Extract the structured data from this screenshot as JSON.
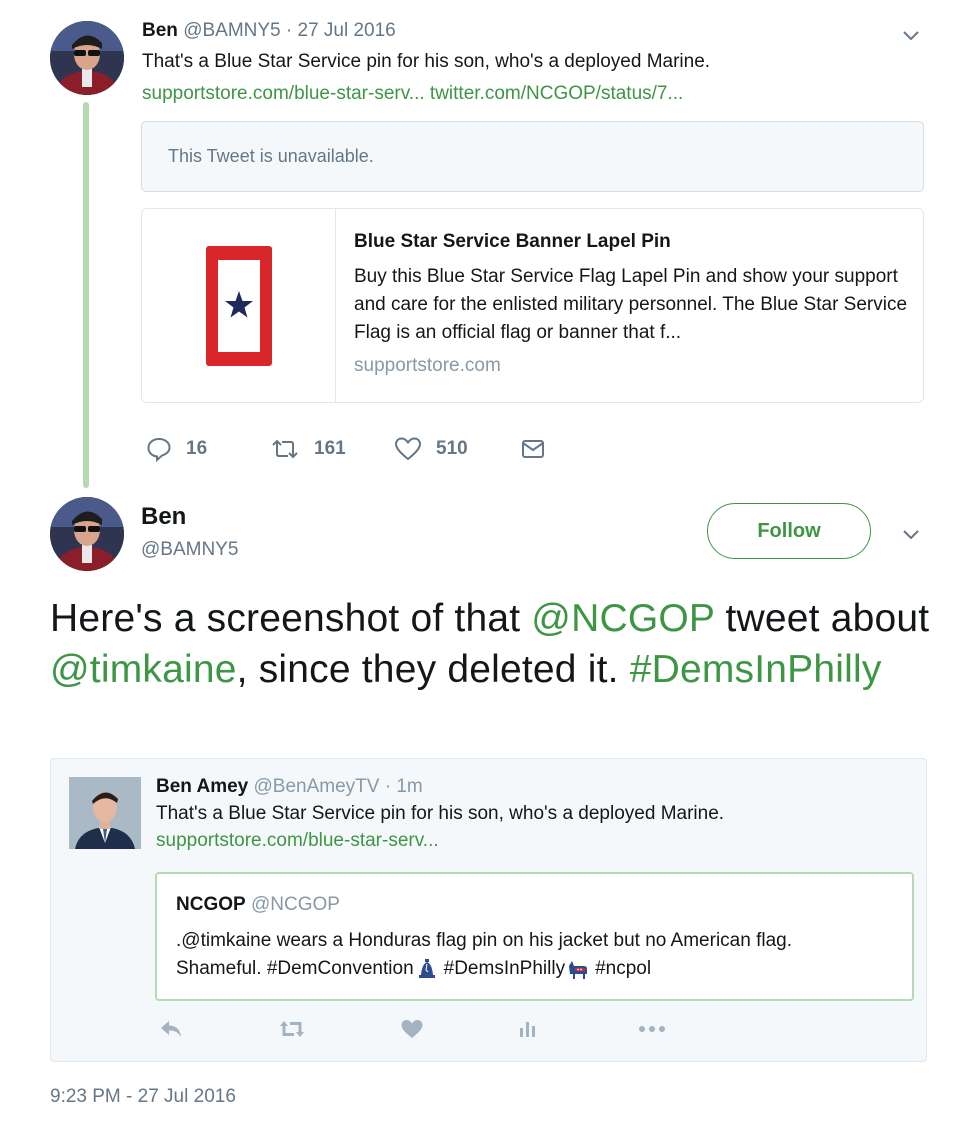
{
  "tweet1": {
    "name": "Ben",
    "handle": "@BAMNY5",
    "date": "· 27 Jul 2016",
    "text": "That's a Blue Star Service pin for his son, who's a deployed Marine.",
    "link1": "supportstore.com/blue-star-serv...",
    "link2": "twitter.com/NCGOP/status/7...",
    "unavailable": "This Tweet is unavailable.",
    "card": {
      "title": "Blue Star Service Banner Lapel Pin",
      "description": "Buy this Blue Star Service Flag Lapel Pin and show your support and care for the enlisted military personnel. The Blue Star Service Flag is an official flag or banner that f...",
      "domain": "supportstore.com"
    },
    "actions": {
      "replies": "16",
      "retweets": "161",
      "likes": "510"
    }
  },
  "tweet2": {
    "name": "Ben",
    "handle": "@BAMNY5",
    "follow_label": "Follow",
    "text_parts": {
      "p1": "Here's a screenshot of that ",
      "mention1": "@NCGOP",
      "p2": " tweet about ",
      "mention2": "@timkaine",
      "p3": ", since they deleted it. ",
      "hashtag": "#DemsInPhilly"
    },
    "timestamp": "9:23 PM - 27 Jul 2016"
  },
  "embedded": {
    "name": "Ben Amey",
    "handle": "@BenAmeyTV",
    "time": "· 1m",
    "text": "That's a Blue Star Service pin for his son, who's a deployed Marine.",
    "link": "supportstore.com/blue-star-serv...",
    "quote": {
      "name": "NCGOP",
      "handle": "@NCGOP",
      "line1": ".@timkaine wears a Honduras flag pin on his jacket but no American flag.",
      "line2_a": "Shameful. #DemConvention",
      "line2_b": " #DemsInPhilly",
      "line2_c": " #ncpol"
    }
  },
  "colors": {
    "accent": "#3e9645",
    "thread_line": "#b6d9b4",
    "muted": "#657786"
  }
}
